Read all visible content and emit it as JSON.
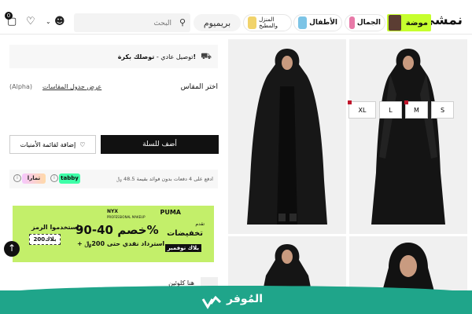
{
  "header": {
    "logo": "نمشي",
    "nav": {
      "moda": "موضة",
      "jamal": "الجمال",
      "kids": "الأطفال",
      "home": "المنزل والمطبخ",
      "premium": "بريميوم"
    },
    "search_placeholder": "البحث",
    "cart_count": "0"
  },
  "shipping": {
    "label": "توصيل عادي -",
    "value": "توصلك بكرة!"
  },
  "size": {
    "title": "اختر المقاس",
    "chart_link": "عرض جدول المقاسات",
    "system": "(Alpha)",
    "options": [
      "S",
      "M",
      "L",
      "XL"
    ]
  },
  "actions": {
    "add_to_cart": "أضف للسلة",
    "add_to_wishlist": "إضافة لقائمة الأمنيات"
  },
  "installments": {
    "text": "ادفع على 4 دفعات بدون فوائد بقيمة 48.5 ﷼",
    "tabby": "tabby",
    "tamara": "تمارا"
  },
  "banner": {
    "brand1": "PUMA",
    "brand2": "NYX",
    "brand2_sub": "PROFESSIONAL MAKEUP",
    "presents": "تقدم",
    "deals": "تخفيضات",
    "november": "بلاك نوفمبر",
    "discount": "خصم 40-90%",
    "cashback": "+ استرداد نقدي حتى 200﷼",
    "code_label": "استخدموا الرمز:",
    "code": "بلاك200",
    "code_alt": "200"
  },
  "here_label": "هنا كلوئين",
  "watermark": "المُوفر",
  "colors": {
    "accent": "#c6ff2e",
    "banner": "#c3ef6a",
    "footer": "#1fa58a",
    "tabby": "#3effa8"
  }
}
